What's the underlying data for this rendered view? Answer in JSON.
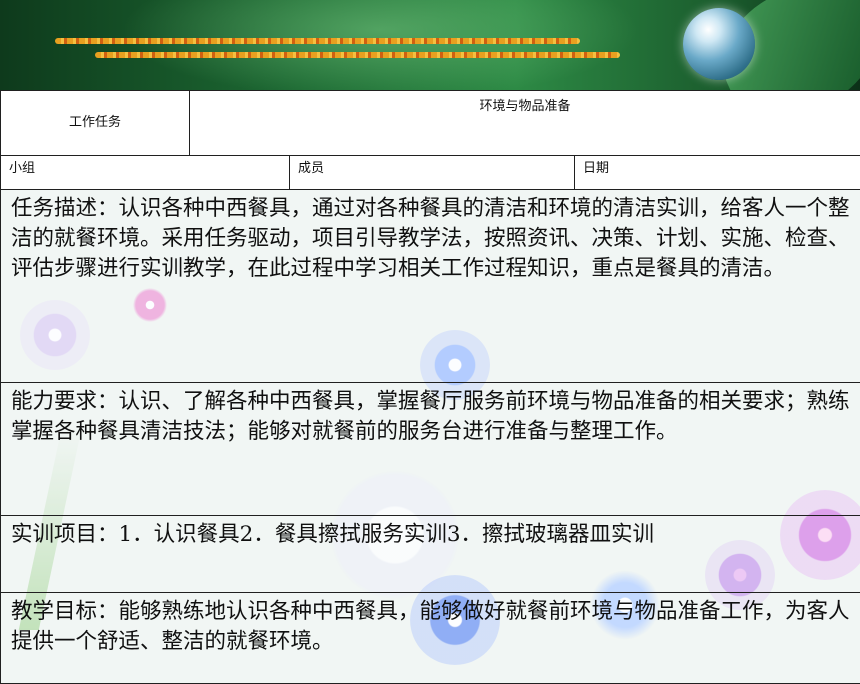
{
  "table": {
    "task_label": "工作任务",
    "task_title": "环境与物品准备",
    "group_label": "小组",
    "members_label": "成员",
    "date_label": "日期"
  },
  "sections": {
    "description": "任务描述：认识各种中西餐具，通过对各种餐具的清洁和环境的清洁实训，给客人一个整洁的就餐环境。采用任务驱动，项目引导教学法，按照资讯、决策、计划、实施、检查、评估步骤进行实训教学，在此过程中学习相关工作过程知识，重点是餐具的清洁。",
    "ability": "能力要求：认识、了解各种中西餐具，掌握餐厅服务前环境与物品准备的相关要求；熟练掌握各种餐具清洁技法；能够对就餐前的服务台进行准备与整理工作。",
    "projects": "实训项目：1．认识餐具2．餐具擦拭服务实训3．擦拭玻璃器皿实训",
    "goal": "教学目标：能够熟练地认识各种中西餐具，能够做好就餐前环境与物品准备工作，为客人提供一个舒适、整洁的就餐环境。"
  },
  "colors": {
    "banner_green": "#1d6a33",
    "wave_orange": "#e8a020",
    "border": "#202020"
  }
}
